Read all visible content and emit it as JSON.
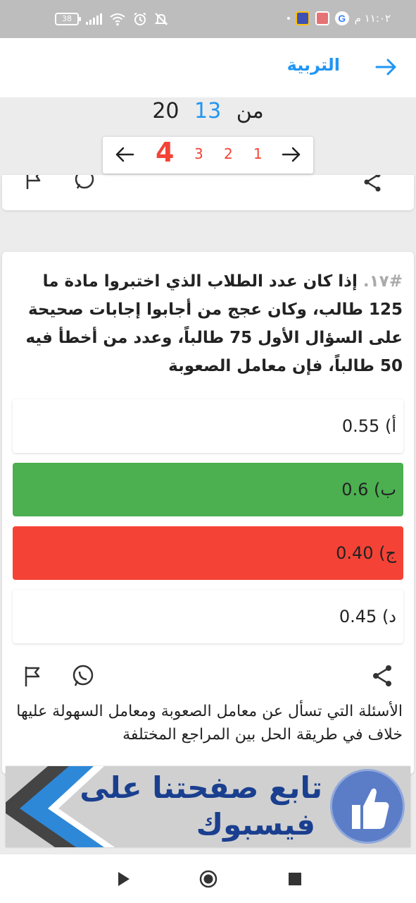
{
  "status_bar": {
    "time": "١١:٠٢ م",
    "battery": "38",
    "icons": [
      "game-app-icon",
      "photo-app-icon",
      "google-icon",
      "signal-icon",
      "wifi-icon",
      "alarm-icon",
      "mute-icon"
    ],
    "google_letter": "G"
  },
  "app_bar": {
    "title": "التربية",
    "back_icon": "arrow-right-icon"
  },
  "progress": {
    "current": "13",
    "of": "من",
    "total": "20"
  },
  "pager": {
    "pages": [
      "1",
      "2",
      "3",
      "4"
    ],
    "active_page": "4",
    "prev_icon": "arrow-right-icon",
    "next_icon": "arrow-left-icon"
  },
  "question": {
    "number": "#١٧.",
    "text": "إذا كان عدد الطلاب الذي اختبروا مادة ما 125 طالب، وكان عجج من أجابوا إجابات صحيحة على السؤال الأول 75 طالباً، وعدد من أخطأ فيه 50 طالباً، فإن معامل الصعوبة",
    "options": [
      {
        "label": "أ) 0.55",
        "state": "neutral"
      },
      {
        "label": "ب) 0.6",
        "state": "correct"
      },
      {
        "label": "ج) 0.40",
        "state": "wrong"
      },
      {
        "label": "د) 0.45",
        "state": "neutral"
      }
    ],
    "actions": [
      "share-icon",
      "whatsapp-icon",
      "flag-icon"
    ],
    "explanation": "الأسئلة التي تسأل عن معامل الصعوبة ومعامل السهولة عليها خلاف في طريقة الحل بين المراجع المختلفة"
  },
  "banner": {
    "line1": "تابع صفحتنا على",
    "line2": "فيسبوك"
  },
  "colors": {
    "accent": "#2196f3",
    "correct": "#4caf50",
    "wrong": "#f44336",
    "page_number": "#f44336"
  }
}
